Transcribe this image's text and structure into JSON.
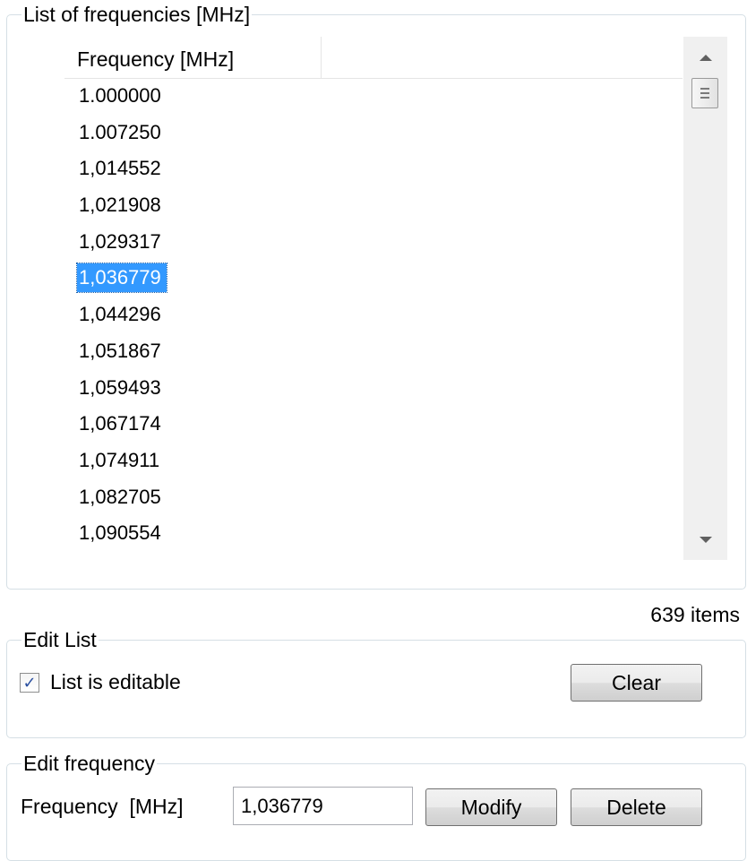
{
  "list_group": {
    "title": "List of frequencies [MHz]",
    "column_header": "Frequency [MHz]",
    "rows": [
      "1.000000",
      "1.007250",
      "1,014552",
      "1,021908",
      "1,029317",
      "1,036779",
      "1,044296",
      "1,051867",
      "1,059493",
      "1,067174",
      "1,074911",
      "1,082705",
      "1,090554"
    ],
    "selected_row": "1,036779",
    "item_count": "639 items"
  },
  "edit_list_group": {
    "title": "Edit List",
    "checkbox_label": "List is editable",
    "checkbox_checked": true,
    "clear_label": "Clear"
  },
  "edit_frequency_group": {
    "title": "Edit frequency",
    "field_label": "Frequency  [MHz]",
    "field_value": "1,036779",
    "modify_label": "Modify",
    "delete_label": "Delete"
  },
  "colors": {
    "selection": "#3399ff",
    "groupbox_border": "#d5dfe5",
    "checkmark": "#2a4fa0"
  },
  "icons": {
    "scroll_up": "scroll-up-arrow-icon",
    "scroll_down": "scroll-down-arrow-icon",
    "check": "checkmark-icon"
  }
}
